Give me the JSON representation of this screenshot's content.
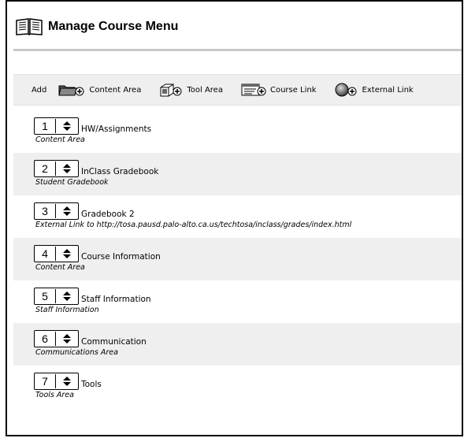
{
  "header": {
    "title": "Manage Course Menu",
    "icon": "book-icon"
  },
  "toolbar": {
    "add_label": "Add",
    "buttons": [
      {
        "label": "Content Area",
        "icon": "folder-add-icon"
      },
      {
        "label": "Tool Area",
        "icon": "tools-add-icon"
      },
      {
        "label": "Course Link",
        "icon": "link-add-icon"
      },
      {
        "label": "External Link",
        "icon": "globe-add-icon"
      }
    ]
  },
  "menu_items": [
    {
      "order": "1",
      "name": "HW/Assignments",
      "type": "Content Area"
    },
    {
      "order": "2",
      "name": "InClass Gradebook",
      "type": "Student Gradebook"
    },
    {
      "order": "3",
      "name": "Gradebook 2",
      "type": "External Link to http://tosa.pausd.palo-alto.ca.us/techtosa/inclass/grades/index.html"
    },
    {
      "order": "4",
      "name": "Course Information",
      "type": "Content Area"
    },
    {
      "order": "5",
      "name": "Staff Information",
      "type": "Staff Information"
    },
    {
      "order": "6",
      "name": "Communication",
      "type": "Communications Area"
    },
    {
      "order": "7",
      "name": "Tools",
      "type": "Tools Area"
    }
  ]
}
